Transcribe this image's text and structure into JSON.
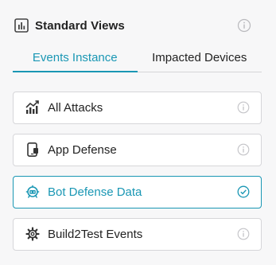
{
  "panel": {
    "title": "Standard Views",
    "title_icon": "bar-chart-box-icon",
    "info_icon": "info-icon"
  },
  "tabs": [
    {
      "label": "Events Instance",
      "active": true
    },
    {
      "label": "Impacted Devices",
      "active": false
    }
  ],
  "views": [
    {
      "label": "All Attacks",
      "icon": "attacks-chart-icon",
      "status_icon": "info-icon",
      "selected": false
    },
    {
      "label": "App Defense",
      "icon": "mobile-device-icon",
      "status_icon": "info-icon",
      "selected": false
    },
    {
      "label": "Bot Defense Data",
      "icon": "bot-icon",
      "status_icon": "check-circle-icon",
      "selected": true
    },
    {
      "label": "Build2Test Events",
      "icon": "gear-icon",
      "status_icon": "info-icon",
      "selected": false
    }
  ],
  "colors": {
    "accent": "#1a97b4",
    "text": "#222222",
    "muted_icon": "#c3c3c7",
    "border": "#d6d6d9",
    "background": "#f7f7f8"
  }
}
